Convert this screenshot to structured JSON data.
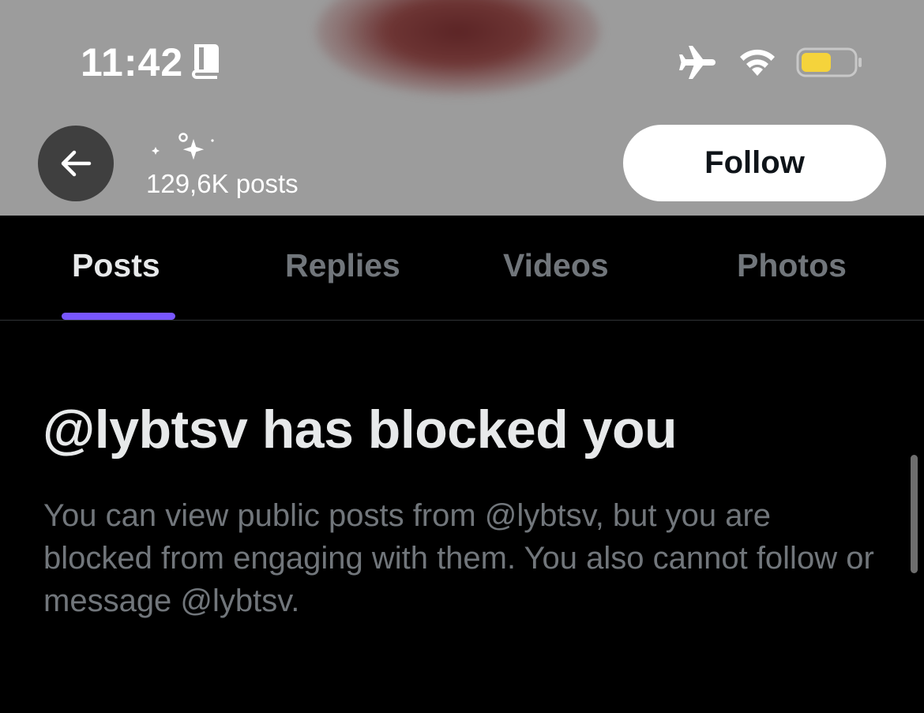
{
  "status_bar": {
    "time": "11:42",
    "icons": [
      "book-icon",
      "airplane-icon",
      "wifi-icon",
      "battery-icon"
    ],
    "battery_color": "#f5d33b"
  },
  "header": {
    "post_count": "129,6K posts",
    "follow_label": "Follow",
    "back_icon": "arrow-left-icon",
    "name_decoration_icon": "sparkles-icon"
  },
  "tabs": [
    {
      "label": "Posts",
      "active": true
    },
    {
      "label": "Replies",
      "active": false
    },
    {
      "label": "Videos",
      "active": false
    },
    {
      "label": "Photos",
      "active": false
    }
  ],
  "notice": {
    "title": "@lybtsv has blocked you",
    "description": "You can view public posts from @lybtsv, but you are blocked from engaging with them. You also cannot follow or message @lybtsv."
  },
  "colors": {
    "accent": "#7856ff",
    "background": "#000000",
    "text_primary": "#e7e9ea",
    "text_secondary": "#71767b"
  }
}
